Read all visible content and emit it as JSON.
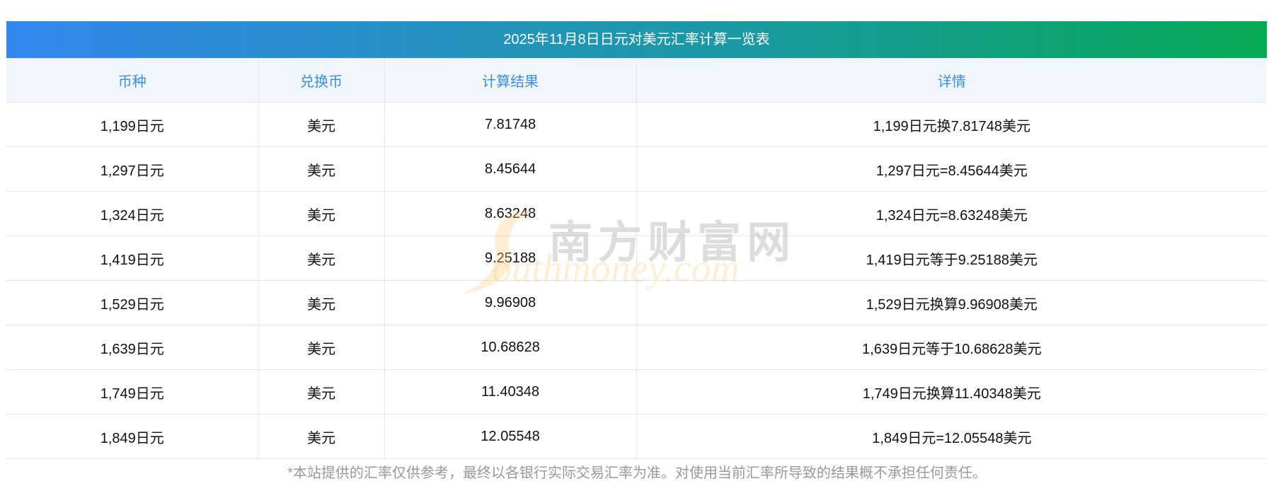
{
  "title": "2025年11月8日日元对美元汇率计算一览表",
  "columns": [
    "币种",
    "兑换币",
    "计算结果",
    "详情"
  ],
  "rows": [
    [
      "1,199日元",
      "美元",
      "7.81748",
      "1,199日元换7.81748美元"
    ],
    [
      "1,297日元",
      "美元",
      "8.45644",
      "1,297日元=8.45644美元"
    ],
    [
      "1,324日元",
      "美元",
      "8.63248",
      "1,324日元=8.63248美元"
    ],
    [
      "1,419日元",
      "美元",
      "9.25188",
      "1,419日元等于9.25188美元"
    ],
    [
      "1,529日元",
      "美元",
      "9.96908",
      "1,529日元换算9.96908美元"
    ],
    [
      "1,639日元",
      "美元",
      "10.68628",
      "1,639日元等于10.68628美元"
    ],
    [
      "1,749日元",
      "美元",
      "11.40348",
      "1,749日元换算11.40348美元"
    ],
    [
      "1,849日元",
      "美元",
      "12.05548",
      "1,849日元=12.05548美元"
    ]
  ],
  "watermark": {
    "cn": "南方财富网",
    "en": "outhmoney.com"
  },
  "note": "*本站提供的汇率仅供参考，最终以各银行实际交易汇率为准。对使用当前汇率所导致的结果概不承担任何责任。"
}
